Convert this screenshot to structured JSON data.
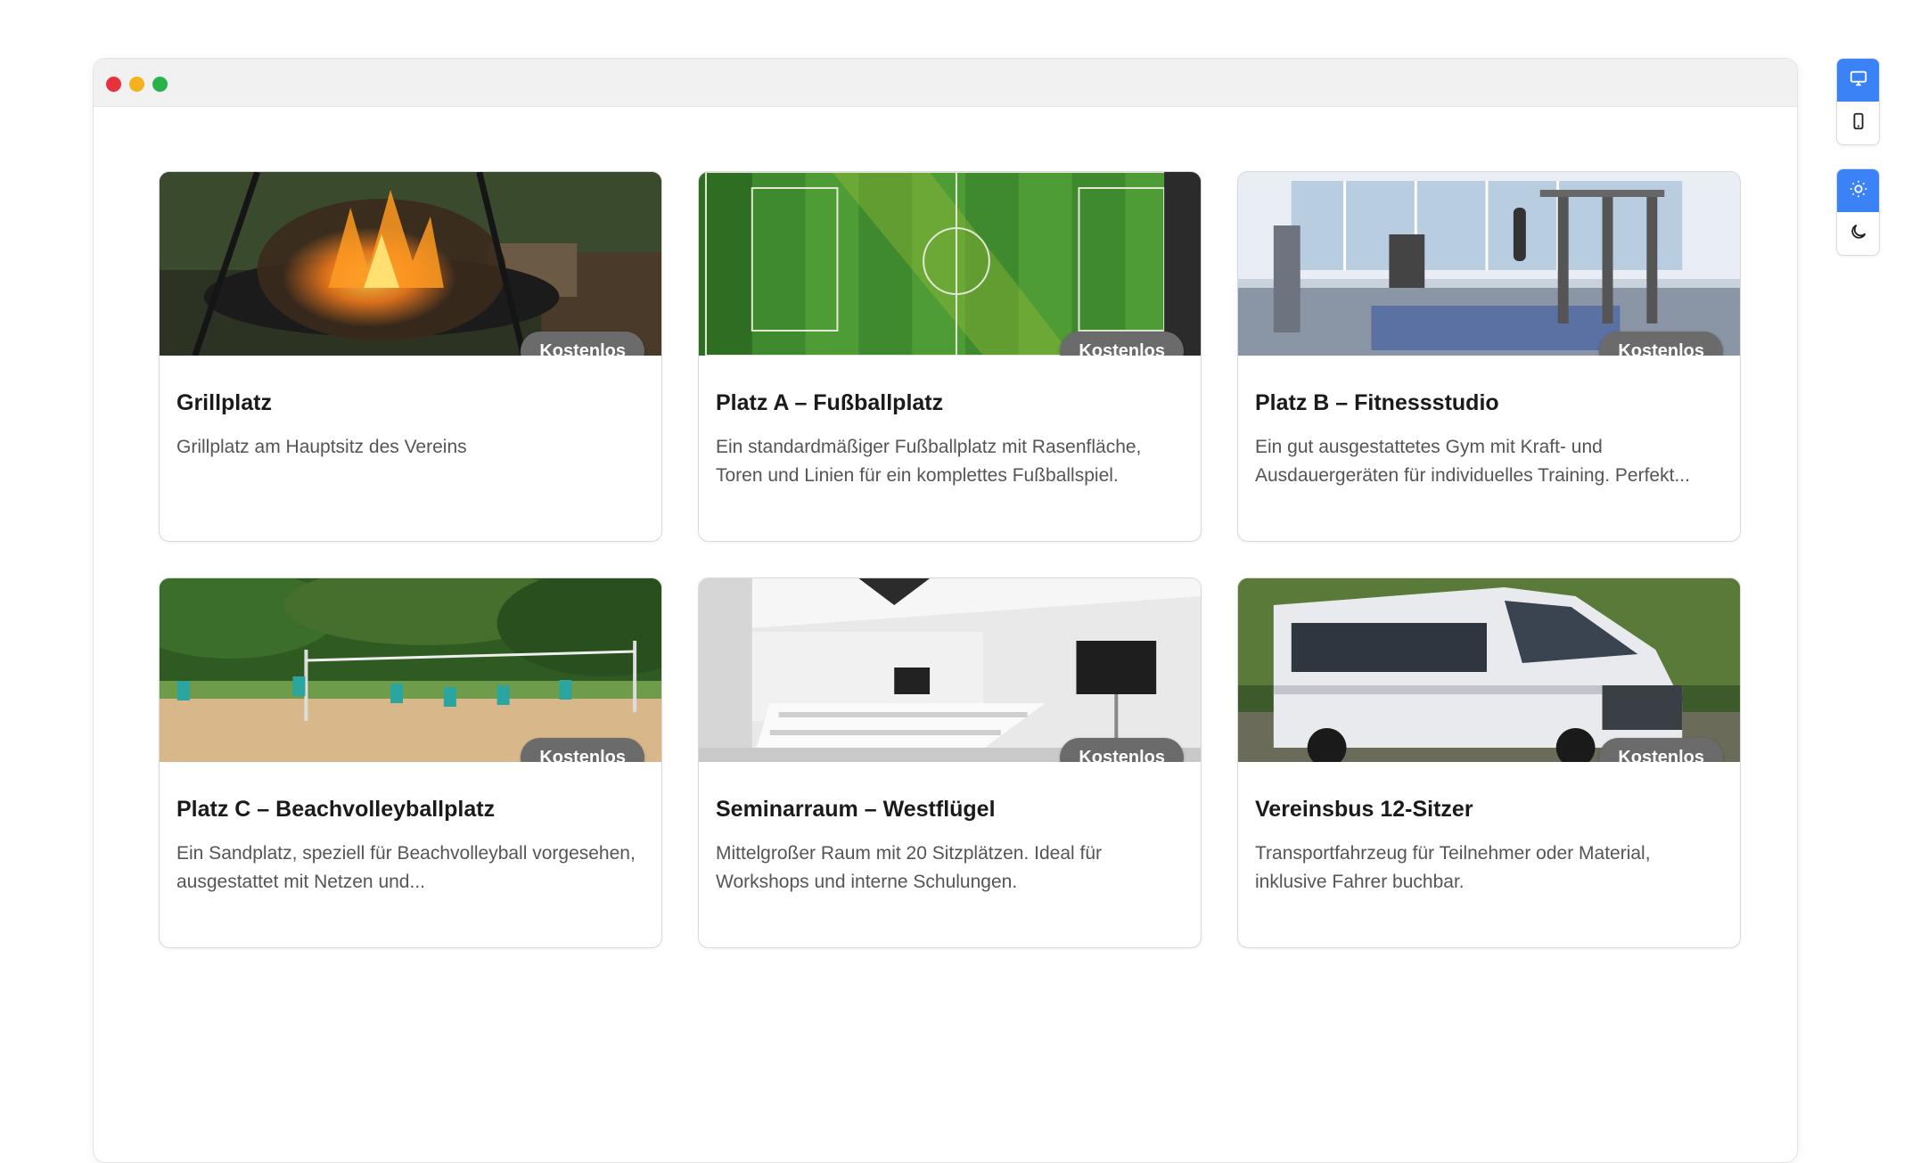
{
  "window": {
    "controls": [
      "close",
      "minimize",
      "maximize"
    ]
  },
  "cards": [
    {
      "title": "Grillplatz",
      "description": "Grillplatz am Hauptsitz des Vereins",
      "badge": "Kostenlos",
      "image": "campfire-grill-photo"
    },
    {
      "title": "Platz A – Fußballplatz",
      "description": "Ein standardmäßiger Fußballplatz mit Rasenfläche, Toren und Linien für ein komplettes Fußballspiel.",
      "badge": "Kostenlos",
      "image": "football-field-aerial-photo"
    },
    {
      "title": "Platz B – Fitnessstudio",
      "description": "Ein gut ausgestattetes Gym mit Kraft- und Ausdauergeräten für individuelles Training. Perfekt...",
      "badge": "Kostenlos",
      "image": "gym-interior-photo"
    },
    {
      "title": "Platz C – Beachvolleyballplatz",
      "description": "Ein Sandplatz, speziell für Beachvolleyball vorgesehen, ausgestattet mit Netzen und...",
      "badge": "Kostenlos",
      "image": "beach-volleyball-photo"
    },
    {
      "title": "Seminarraum – Westflügel",
      "description": "Mittelgroßer Raum mit 20 Sitzplätzen. Ideal für Workshops und interne Schulungen.",
      "badge": "Kostenlos",
      "image": "seminar-room-photo"
    },
    {
      "title": "Vereinsbus 12-Sitzer",
      "description": "Transportfahrzeug für Teilnehmer oder Material, inklusive Fahrer buchbar.",
      "badge": "Kostenlos",
      "image": "white-van-photo"
    }
  ],
  "toolbar": {
    "view": [
      {
        "icon": "desktop-icon",
        "active": true
      },
      {
        "icon": "mobile-icon",
        "active": false
      }
    ],
    "theme": [
      {
        "icon": "sun-icon",
        "active": true
      },
      {
        "icon": "moon-icon",
        "active": false
      }
    ]
  },
  "colors": {
    "accent": "#3b82f6",
    "badge": "#6b6b6b"
  }
}
